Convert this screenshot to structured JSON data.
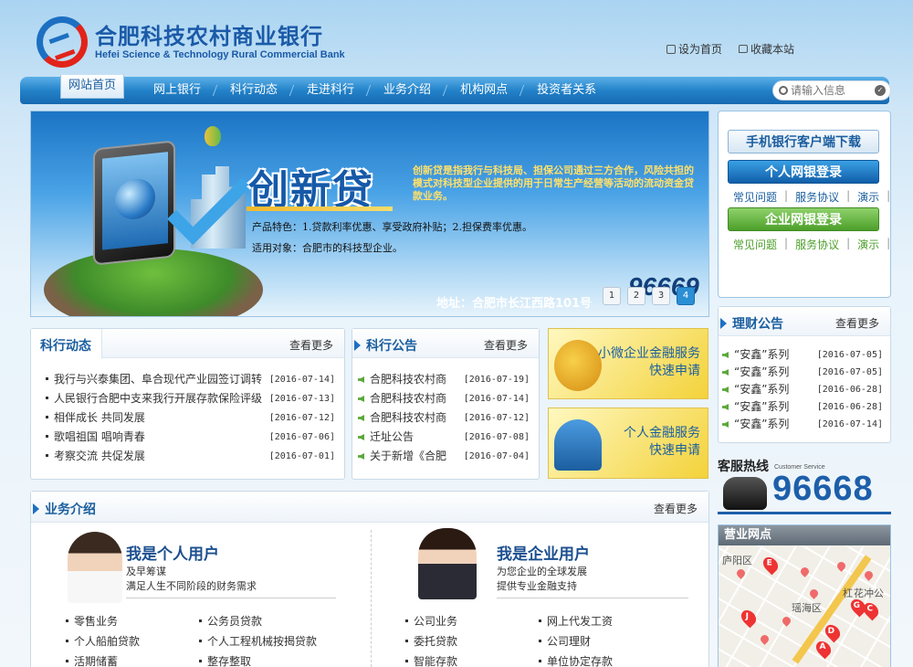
{
  "header": {
    "logo_cn": "合肥科技农村商业银行",
    "logo_en": "Hefei Science & Technology Rural Commercial Bank",
    "set_home": "设为首页",
    "bookmark": "收藏本站"
  },
  "nav": {
    "home": "网站首页",
    "items": [
      "网上银行",
      "科行动态",
      "走进科行",
      "业务介绍",
      "机构网点",
      "投资者关系"
    ],
    "search_placeholder": "请输入信息"
  },
  "banner": {
    "title": "创新贷",
    "desc": "创新贷是指我行与科技局、担保公司通过三方合作，风险共担的模式对科技型企业提供的用于日常生产经营等活动的流动资金贷款业务。",
    "feature": "产品特色：1.贷款利率优惠、享受政府补贴；2.担保费率优惠。",
    "target": "适用对象：合肥市的科技型企业。",
    "phone": "96669",
    "address": "地址：合肥市长江西路101号",
    "pages": [
      "1",
      "2",
      "3",
      "4"
    ],
    "active_page": 4
  },
  "login": {
    "mobile": "手机银行客户端下载",
    "personal": "个人网银登录",
    "corporate": "企业网银登录",
    "links": [
      "常见问题",
      "服务协议",
      "演示"
    ],
    "colors": {
      "blue": "#1d6fc2",
      "green": "#4c9f2a"
    }
  },
  "news": {
    "title": "科行动态",
    "more": "查看更多",
    "items": [
      {
        "text": "我行与兴泰集团、阜合现代产业园签订调转",
        "date": "[2016-07-14]"
      },
      {
        "text": "人民银行合肥中支来我行开展存款保险评级",
        "date": "[2016-07-13]"
      },
      {
        "text": "相伴成长 共同发展",
        "date": "[2016-07-12]"
      },
      {
        "text": "歌唱祖国 唱响青春",
        "date": "[2016-07-06]"
      },
      {
        "text": "考察交流 共促发展",
        "date": "[2016-07-01]"
      }
    ]
  },
  "notice": {
    "title": "科行公告",
    "more": "查看更多",
    "items": [
      {
        "text": "合肥科技农村商",
        "date": "[2016-07-19]"
      },
      {
        "text": "合肥科技农村商",
        "date": "[2016-07-14]"
      },
      {
        "text": "合肥科技农村商",
        "date": "[2016-07-12]"
      },
      {
        "text": "迁址公告",
        "date": "[2016-07-08]"
      },
      {
        "text": "关于新增《合肥",
        "date": "[2016-07-04]"
      }
    ]
  },
  "promos": [
    {
      "line1": "小微企业金融服务",
      "line2": "快速申请"
    },
    {
      "line1": "个人金融服务",
      "line2": "快速申请"
    }
  ],
  "finance": {
    "title": "理财公告",
    "more": "查看更多",
    "items": [
      {
        "text": "“安鑫”系列",
        "date": "[2016-07-05]"
      },
      {
        "text": "“安鑫”系列",
        "date": "[2016-07-05]"
      },
      {
        "text": "“安鑫”系列",
        "date": "[2016-06-28]"
      },
      {
        "text": "“安鑫”系列",
        "date": "[2016-06-28]"
      },
      {
        "text": "“安鑫”系列",
        "date": "[2016-07-14]"
      }
    ]
  },
  "hotline": {
    "label": "客服热线",
    "label_en": "Customer Service",
    "number": "96668"
  },
  "map": {
    "title": "营业网点",
    "labels": [
      "庐阳区",
      "瑶海区",
      "杠",
      "花冲公"
    ],
    "pins": [
      "E",
      "J",
      "D",
      "A",
      "G",
      "C"
    ]
  },
  "business": {
    "title": "业务介绍",
    "more": "查看更多",
    "personal": {
      "heading": "我是个人用户",
      "sub1": "及早筹谋",
      "sub2": "满足人生不同阶段的财务需求",
      "items": [
        "零售业务",
        "公务员贷款",
        "个人船舶贷款",
        "个人工程机械按揭贷款",
        "活期储蓄",
        "整存整取"
      ]
    },
    "corporate": {
      "heading": "我是企业用户",
      "sub1": "为您企业的全球发展",
      "sub2": "提供专业金融支持",
      "items": [
        "公司业务",
        "网上代发工资",
        "委托贷款",
        "公司理财",
        "智能存款",
        "单位协定存款"
      ]
    }
  }
}
